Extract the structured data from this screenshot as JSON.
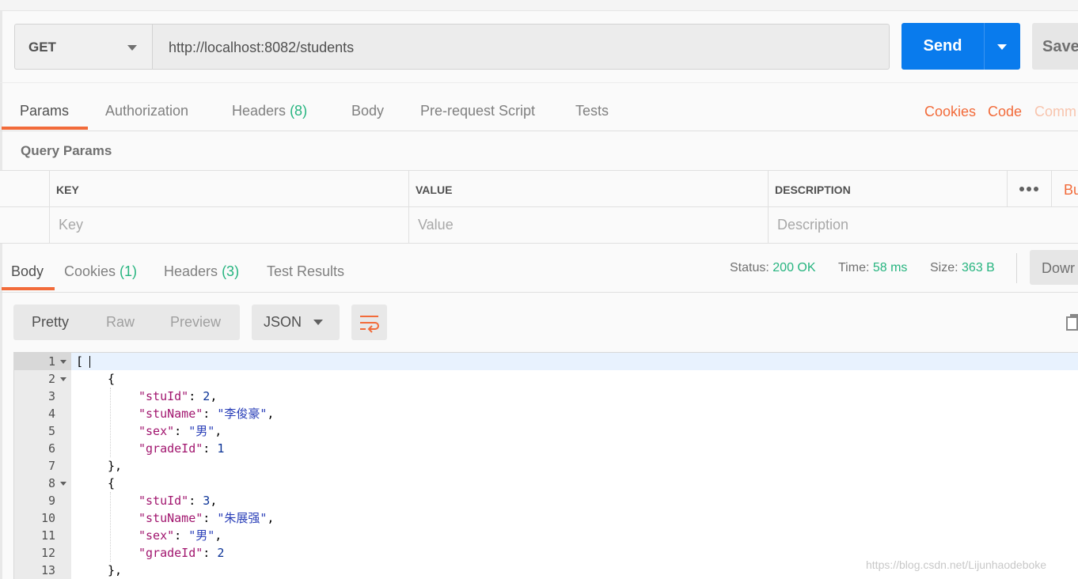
{
  "request": {
    "method": "GET",
    "url": "http://localhost:8082/students",
    "send_label": "Send",
    "save_label": "Save"
  },
  "request_tabs": {
    "params": "Params",
    "authorization": "Authorization",
    "headers": "Headers",
    "headers_count": "(8)",
    "body": "Body",
    "prerequest": "Pre-request Script",
    "tests": "Tests",
    "cookies": "Cookies",
    "code": "Code",
    "comments": "Comm"
  },
  "query_params": {
    "title": "Query Params",
    "col_key": "KEY",
    "col_value": "VALUE",
    "col_description": "DESCRIPTION",
    "bulk_edit": "Bu",
    "key_placeholder": "Key",
    "value_placeholder": "Value",
    "description_placeholder": "Description"
  },
  "response_tabs": {
    "body": "Body",
    "cookies": "Cookies",
    "cookies_count": "(1)",
    "headers": "Headers",
    "headers_count": "(3)",
    "test_results": "Test Results"
  },
  "response_status": {
    "status_label": "Status:",
    "status_value": "200 OK",
    "time_label": "Time:",
    "time_value": "58 ms",
    "size_label": "Size:",
    "size_value": "363 B",
    "download_label": "Dowr"
  },
  "view": {
    "pretty": "Pretty",
    "raw": "Raw",
    "preview": "Preview",
    "format": "JSON"
  },
  "code_lines": {
    "n1": "1",
    "n2": "2",
    "n3": "3",
    "n4": "4",
    "n5": "5",
    "n6": "6",
    "n7": "7",
    "n8": "8",
    "n9": "9",
    "n10": "10",
    "n11": "11",
    "n12": "12",
    "n13": "13"
  },
  "json_tokens": {
    "open_bracket": "[",
    "open_brace": "{",
    "close_brace_comma": "},",
    "k_stuId": "\"stuId\"",
    "k_stuName": "\"stuName\"",
    "k_sex": "\"sex\"",
    "k_gradeId": "\"gradeId\"",
    "s1_stuId": "2",
    "s1_stuName": "\"李俊豪\"",
    "s1_sex": "\"男\"",
    "s1_gradeId": "1",
    "s2_stuId": "3",
    "s2_stuName": "\"朱展强\"",
    "s2_sex": "\"男\"",
    "s2_gradeId": "2"
  },
  "watermark": "https://blog.csdn.net/Lijunhaodeboke",
  "colors": {
    "accent_orange": "#f26b3a",
    "send_blue": "#097bed",
    "status_green": "#26b47f"
  }
}
